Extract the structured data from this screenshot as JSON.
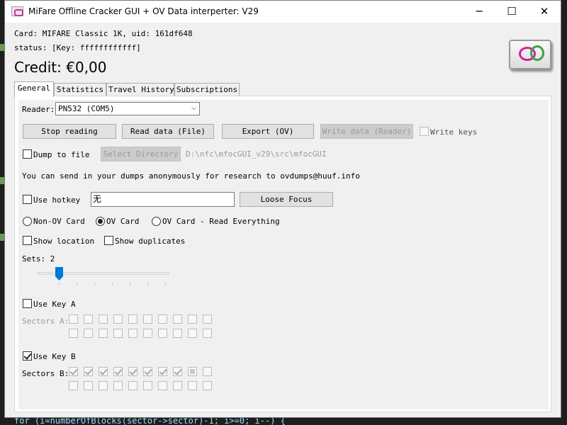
{
  "window": {
    "title": "MiFare Offline Cracker GUI + OV Data interperter: V29",
    "minimize_glyph": "─",
    "maximize_glyph": "☐",
    "close_glyph": "✕"
  },
  "info": {
    "card_line": "Card: MIFARE Classic 1K, uid: 161df648",
    "status_line": "status: [Key: ffffffffffff]",
    "credit": "Credit: €0,00"
  },
  "tabs": [
    {
      "label": "General",
      "active": true
    },
    {
      "label": "Statistics",
      "active": false
    },
    {
      "label": "Travel History",
      "active": false
    },
    {
      "label": "Subscriptions",
      "active": false
    }
  ],
  "general": {
    "reader_label": "Reader:",
    "reader_value": "PN532 (COM5)",
    "buttons": {
      "stop_reading": "Stop reading",
      "read_data_file": "Read data (File)",
      "export_ov": "Export (OV)",
      "write_data_reader": "Write data (Reader)"
    },
    "write_keys_label": "Write keys",
    "dump_to_file_label": "Dump to file",
    "select_directory": "Select Directory",
    "dump_path": "D:\\nfc\\mfocGUI_v29\\src\\mfocGUI",
    "share_text": "You can send in your dumps anonymously for research to ovdumps@huuf.info",
    "use_hotkey_label": "Use hotkey",
    "hotkey_value": "无",
    "loose_focus": "Loose Focus",
    "card_modes": [
      {
        "label": "Non-OV Card",
        "selected": false
      },
      {
        "label": "OV Card",
        "selected": true
      },
      {
        "label": "OV Card - Read Everything",
        "selected": false
      }
    ],
    "show_location_label": "Show location",
    "show_duplicates_label": "Show duplicates",
    "sets_label": "Sets: 2",
    "sets_value": 2,
    "use_key_a_label": "Use Key A",
    "sectors_a_label": "Sectors A:",
    "use_key_b_label": "Use Key B",
    "sectors_b_label": "Sectors B:",
    "sectors_b_state": [
      "checked",
      "checked",
      "checked",
      "checked",
      "checked",
      "checked",
      "checked",
      "checked",
      "indeterminate",
      "empty",
      "empty",
      "empty",
      "empty",
      "empty",
      "empty",
      "empty",
      "empty",
      "empty",
      "empty",
      "empty"
    ]
  },
  "background_code": "for (i=numberOfBlocks(sector->sector)-1; i>=0; i--) {",
  "colors": {
    "slider_thumb": "#0078d7",
    "title_bg": "#ffffff",
    "window_bg": "#f0f0f0",
    "editor_bg": "#1e1e1e"
  }
}
